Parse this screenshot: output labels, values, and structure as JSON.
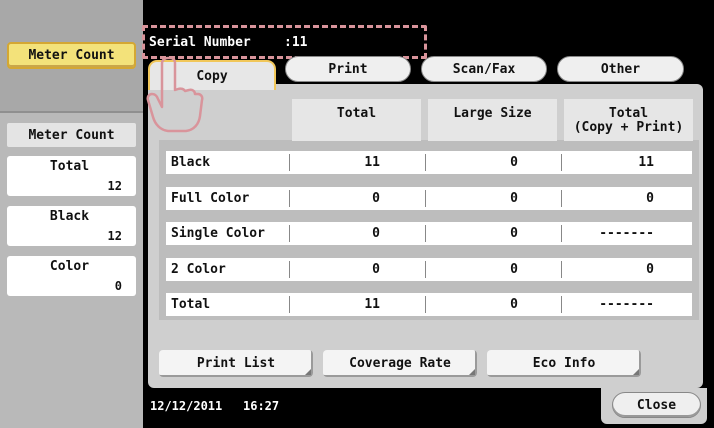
{
  "sidebar": {
    "active_button": "Meter Count",
    "header": "Meter Count",
    "cards": [
      {
        "label": "Total",
        "value": "12"
      },
      {
        "label": "Black",
        "value": "12"
      },
      {
        "label": "Color",
        "value": "0"
      }
    ]
  },
  "serial": {
    "label": "Serial Number",
    "value": ":11"
  },
  "tabs": [
    {
      "label": "Copy",
      "active": true
    },
    {
      "label": "Print",
      "active": false
    },
    {
      "label": "Scan/Fax",
      "active": false
    },
    {
      "label": "Other",
      "active": false
    }
  ],
  "table": {
    "headers": [
      "Total",
      "Large Size",
      "Total\n(Copy + Print)"
    ],
    "rows": [
      {
        "name": "Black",
        "values": [
          "11",
          "0",
          "11"
        ]
      },
      {
        "name": "Full Color",
        "values": [
          "0",
          "0",
          "0"
        ]
      },
      {
        "name": "Single Color",
        "values": [
          "0",
          "0",
          "-------"
        ]
      },
      {
        "name": "2 Color",
        "values": [
          "0",
          "0",
          "0"
        ]
      },
      {
        "name": "Total",
        "values": [
          "11",
          "0",
          "-------"
        ]
      }
    ]
  },
  "buttons": {
    "print_list": "Print List",
    "coverage_rate": "Coverage Rate",
    "eco_info": "Eco Info",
    "close": "Close"
  },
  "footer": {
    "date": "12/12/2011",
    "time": "16:27"
  },
  "colors": {
    "active_button": "#f3e27a",
    "highlight_dash": "#d9949b",
    "active_tab_border": "#f1c75a"
  }
}
